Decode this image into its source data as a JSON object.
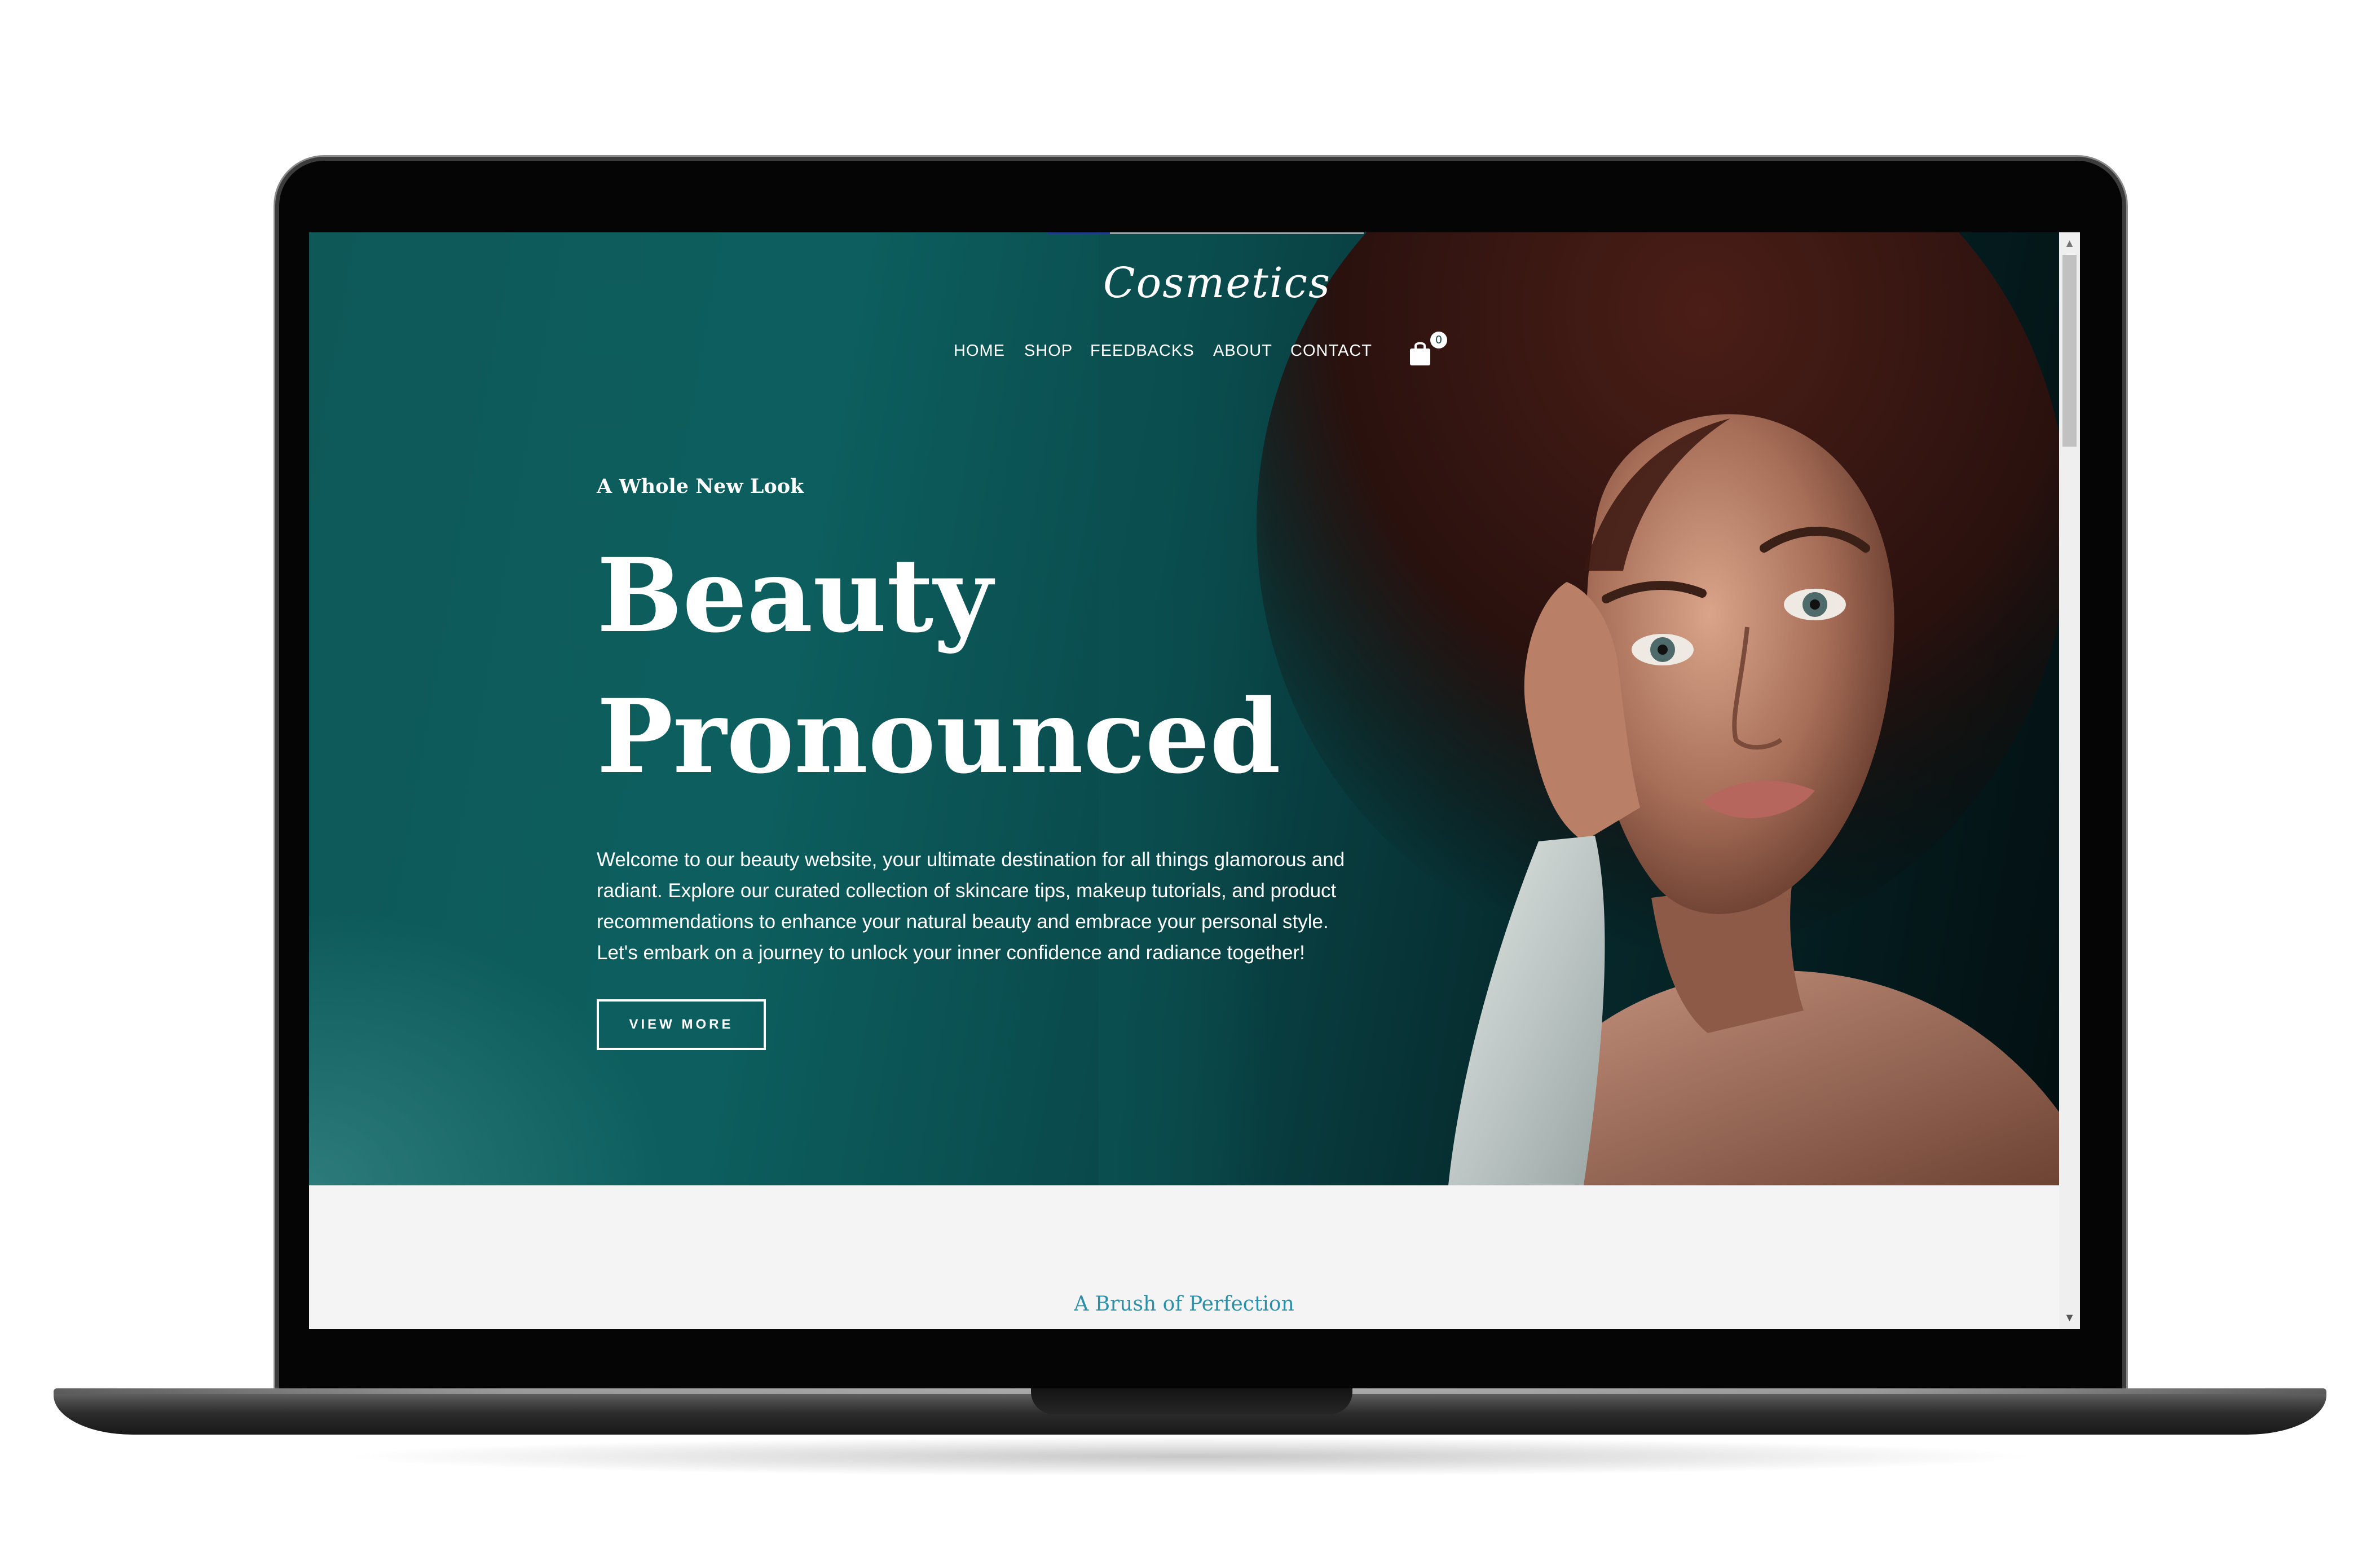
{
  "brand": {
    "logo_text": "Cosmetics"
  },
  "nav": {
    "items": [
      {
        "label": "HOME"
      },
      {
        "label": "SHOP"
      },
      {
        "label": "FEEDBACKS"
      },
      {
        "label": "ABOUT"
      },
      {
        "label": "CONTACT"
      }
    ],
    "cart": {
      "icon": "shopping-bag-icon",
      "count": "0"
    }
  },
  "hero": {
    "eyebrow": "A Whole New Look",
    "headline_line1": "Beauty",
    "headline_line2": "Pronounced",
    "description": "Welcome to our beauty website, your ultimate destination for all things glamorous and radiant. Explore our curated collection of skincare tips, makeup tutorials, and product recommendations to enhance your natural beauty and embrace your personal style. Let's embark on a journey to unlock your inner confidence and radiance together!",
    "cta_label": "VIEW MORE"
  },
  "section": {
    "subheading": "A Brush of Perfection"
  },
  "colors": {
    "hero_teal": "#0d5f5f",
    "hero_dark": "#030f11",
    "accent_text": "#2a8fa8",
    "page_bg": "#f4f4f4"
  }
}
